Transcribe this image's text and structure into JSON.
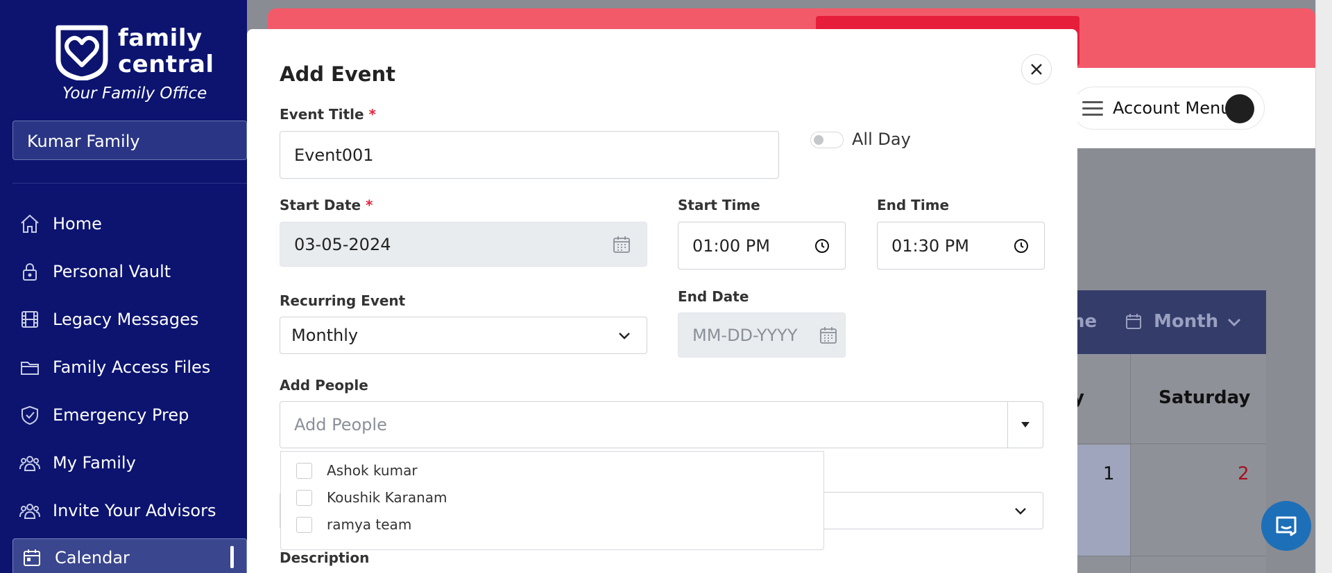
{
  "sidebar": {
    "logo": {
      "word1": "family",
      "word2": "central",
      "tagline": "Your Family Office"
    },
    "family_selector": "Kumar Family",
    "items": [
      {
        "label": "Home",
        "icon": "home-icon"
      },
      {
        "label": "Personal Vault",
        "icon": "lock-icon"
      },
      {
        "label": "Legacy Messages",
        "icon": "film-icon"
      },
      {
        "label": "Family Access Files",
        "icon": "folder-icon"
      },
      {
        "label": "Emergency Prep",
        "icon": "shield-check-icon"
      },
      {
        "label": "My Family",
        "icon": "people-icon"
      },
      {
        "label": "Invite Your Advisors",
        "icon": "people-icon"
      },
      {
        "label": "Calendar",
        "icon": "calendar-icon",
        "active": true
      }
    ]
  },
  "header": {
    "account_menu_label": "Account Menu"
  },
  "calendar_bg": {
    "toolbar_partial_text": "ne",
    "view_label": "Month",
    "day_header_partial": "y",
    "day_header_saturday": "Saturday",
    "date_1": "1",
    "date_2": "2"
  },
  "modal": {
    "title": "Add Event",
    "event_title": {
      "label": "Event Title",
      "required_mark": "*",
      "value": "Event001"
    },
    "all_day": {
      "label": "All Day",
      "checked": false
    },
    "start_date": {
      "label": "Start Date",
      "required_mark": "*",
      "value": "03-05-2024"
    },
    "start_time": {
      "label": "Start Time",
      "value": "01:00 PM"
    },
    "end_time": {
      "label": "End Time",
      "value": "01:30 PM"
    },
    "recurring": {
      "label": "Recurring Event",
      "value": "Monthly"
    },
    "end_date": {
      "label": "End Date",
      "placeholder": "MM-DD-YYYY"
    },
    "add_people": {
      "label": "Add People",
      "placeholder": "Add People",
      "options": [
        "Ashok kumar",
        "Koushik Karanam",
        "ramya team"
      ]
    },
    "description": {
      "label": "Description"
    }
  },
  "colors": {
    "sidebar_bg": "#0c1470",
    "banner": "#f25a6a",
    "required": "#e0243c",
    "chat_button": "#1d6fb8"
  }
}
